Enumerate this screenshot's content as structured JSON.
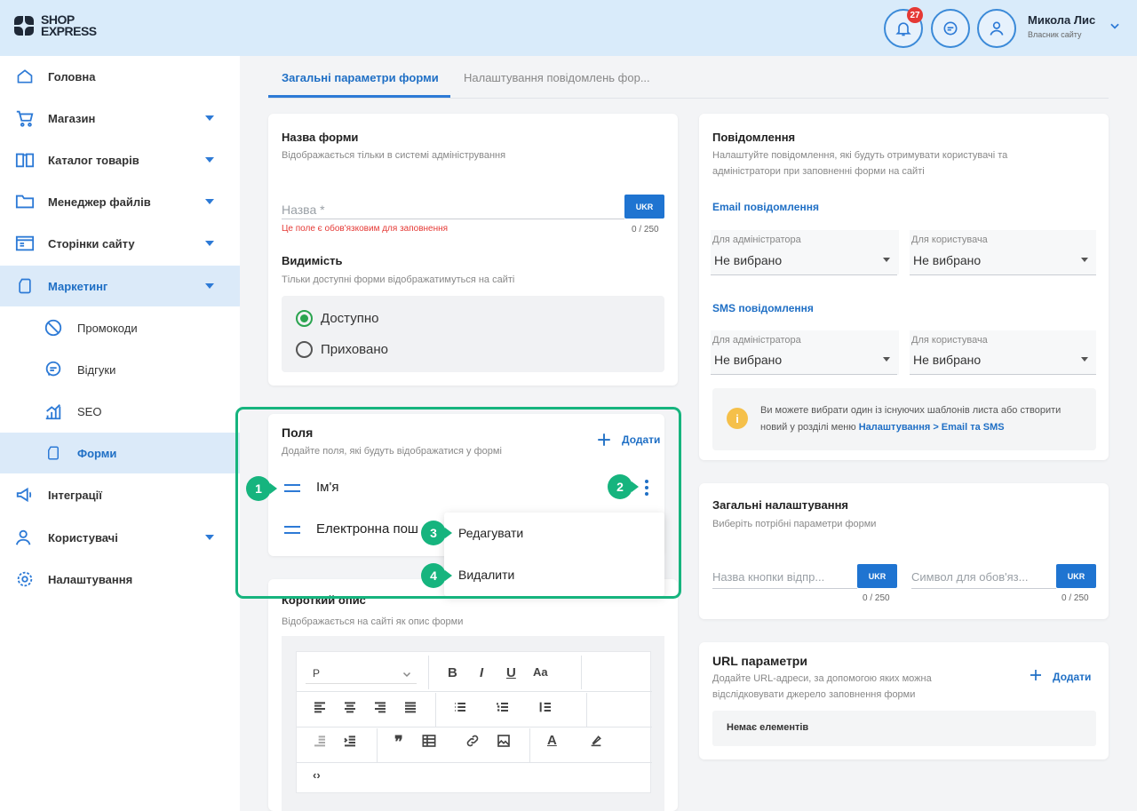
{
  "header": {
    "logo_line1": "SHOP",
    "logo_line2": "EXPRESS",
    "notifications_count": "27",
    "user_name": "Микола Лис",
    "user_role": "Власник сайту"
  },
  "sidebar": {
    "items": [
      {
        "label": "Головна",
        "icon": "home-icon"
      },
      {
        "label": "Магазин",
        "icon": "cart-icon"
      },
      {
        "label": "Каталог товарів",
        "icon": "book-icon"
      },
      {
        "label": "Менеджер файлів",
        "icon": "folder-icon"
      },
      {
        "label": "Сторінки сайту",
        "icon": "pages-icon"
      },
      {
        "label": "Маркетинг",
        "icon": "marketing-icon"
      },
      {
        "label": "Промокоди",
        "icon": "promo-icon"
      },
      {
        "label": "Відгуки",
        "icon": "reviews-icon"
      },
      {
        "label": "SEO",
        "icon": "seo-icon"
      },
      {
        "label": "Форми",
        "icon": "forms-icon"
      },
      {
        "label": "Інтеграції",
        "icon": "megaphone-icon"
      },
      {
        "label": "Користувачі",
        "icon": "users-icon"
      },
      {
        "label": "Налаштування",
        "icon": "settings-icon"
      }
    ]
  },
  "tabs": [
    "Загальні параметри форми",
    "Налаштування повідомлень фор..."
  ],
  "form_name": {
    "title": "Назва форми",
    "subtitle": "Відображається тільки в системі адміністрування",
    "placeholder": "Назва *",
    "lang": "UKR",
    "error": "Це поле є обов'язковим для заповнення",
    "counter": "0 / 250"
  },
  "visibility": {
    "title": "Видимість",
    "subtitle": "Тільки доступні форми відображатимуться на сайті",
    "options": [
      "Доступно",
      "Приховано"
    ]
  },
  "fields": {
    "title": "Поля",
    "subtitle": "Додайте поля, які будуть відображатися у формі",
    "add_label": "Додати",
    "items": [
      "Ім'я",
      "Електронна пош"
    ],
    "menu": [
      "Редагувати",
      "Видалити"
    ],
    "steps": [
      "1",
      "2",
      "3",
      "4"
    ]
  },
  "short_desc": {
    "title": "Короткий опис",
    "subtitle": "Відображається на сайті як опис форми",
    "format_value": "P"
  },
  "notifications": {
    "title": "Повідомлення",
    "subtitle": "Налаштуйте повідомлення, які будуть отримувати користувачі та адміністратори при заповненні форми на сайті",
    "email_title": "Email повідомлення",
    "sms_title": "SMS повідомлення",
    "for_admin": "Для адміністратора",
    "for_user": "Для користувача",
    "not_selected": "Не вибрано",
    "info_text": "Ви можете вибрати один із існуючих шаблонів листа або створити новий у розділі меню ",
    "info_link": "Налаштування > Email та SMS"
  },
  "general": {
    "title": "Загальні налаштування",
    "subtitle": "Виберіть потрібні параметри форми",
    "button_name": "Назва кнопки відпр...",
    "required_symbol": "Символ для обов'яз...",
    "lang": "UKR",
    "counter": "0 / 250"
  },
  "url_params": {
    "title": "URL параметри",
    "subtitle": "Додайте URL-адреси, за допомогою яких можна відслідковувати джерело заповнення форми",
    "add_label": "Додати",
    "empty": "Немає елементів"
  }
}
